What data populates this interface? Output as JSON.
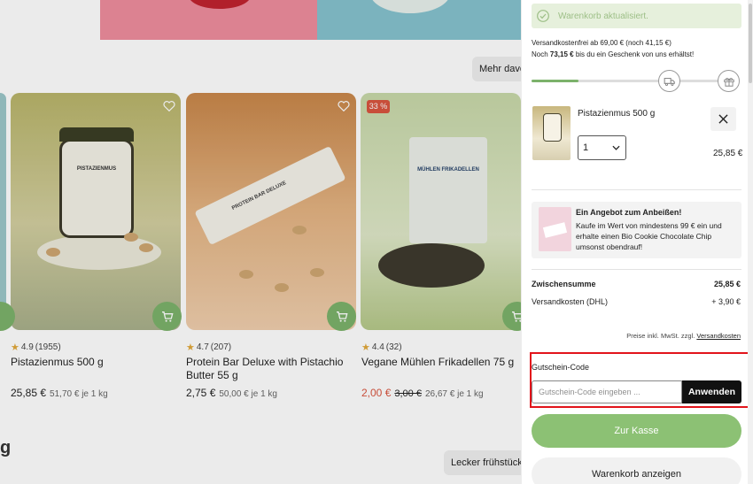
{
  "shop": {
    "more_button": "Mehr davon",
    "more_button_2": "Lecker frühstücken",
    "section_edge_text": "g",
    "products": [
      {
        "name": "Pistazienmus 500 g",
        "rating": "4.9",
        "reviews": "(1955)",
        "price": "25,85 €",
        "unit_price": "51,70 € je 1 kg",
        "image_label": "PISTAZIENMUS"
      },
      {
        "name": "Protein Bar Deluxe with Pistachio Butter 55 g",
        "rating": "4.7",
        "reviews": "(207)",
        "price": "2,75 €",
        "unit_price": "50,00 € je 1 kg",
        "image_label": "PROTEIN BAR DELUXE"
      },
      {
        "name": "Vegane Mühlen Frikadellen 75 g",
        "rating": "4.4",
        "reviews": "(32)",
        "price": "2,00 €",
        "old_price": "3,00 €",
        "unit_price": "26,67 € je 1 kg",
        "badge": "33 %",
        "image_label": "MÜHLEN FRIKADELLEN"
      }
    ],
    "colors": {
      "cart_button": "#7cb26b",
      "sale": "#d9553f",
      "star": "#e2a93b"
    }
  },
  "cart": {
    "toast": "Warenkorb aktualisiert.",
    "shipping_info": "Versandkostenfrei ab 69,00 € (noch 41,15 €)",
    "gift_prefix": "Noch ",
    "gift_amount": "73,15 €",
    "gift_suffix": " bis du ein Geschenk von uns erhältst!",
    "progress_fraction": 0.24,
    "milestone_icons": [
      "truck-icon",
      "gift-icon"
    ],
    "item": {
      "name": "Pistazienmus 500 g",
      "quantity": "1",
      "price": "25,85 €"
    },
    "offer": {
      "title": "Ein Angebot zum Anbeißen!",
      "text": "Kaufe im Wert von mindestens 99 € ein und erhalte einen Bio Cookie Chocolate Chip umsonst obendrauf!"
    },
    "subtotal_label": "Zwischensumme",
    "subtotal_value": "25,85 €",
    "shipping_label": "Versandkosten (DHL)",
    "shipping_value": "+ 3,90 €",
    "tax_note": "Preise inkl. MwSt. zzgl. ",
    "tax_link": "Versandkosten",
    "coupon_label": "Gutschein-Code",
    "coupon_placeholder": "Gutschein-Code eingeben ...",
    "coupon_value": "",
    "coupon_button": "Anwenden",
    "checkout_button": "Zur Kasse",
    "view_cart_button": "Warenkorb anzeigen",
    "colors": {
      "accent": "#8cc174",
      "toast_bg": "#e6f0dc",
      "highlight": "#e2141b"
    }
  }
}
